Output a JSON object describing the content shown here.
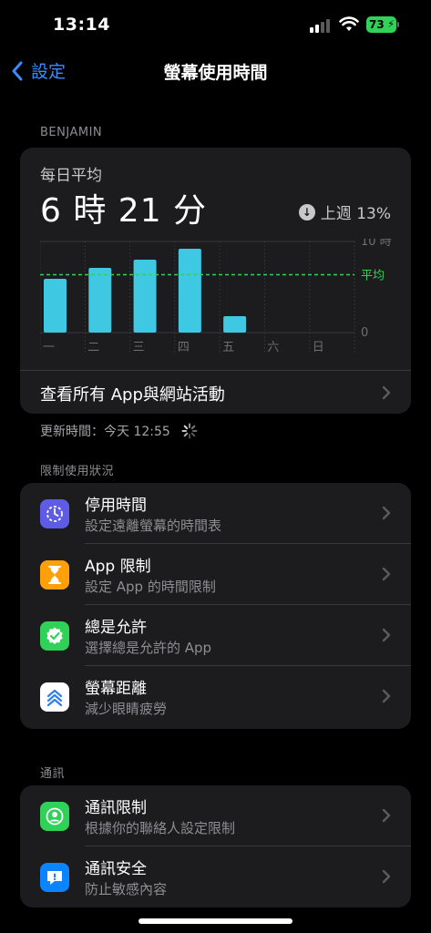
{
  "status": {
    "time": "13:14",
    "battery": "73"
  },
  "nav": {
    "back_label": "設定",
    "title": "螢幕使用時間"
  },
  "user_label": "BENJAMIN",
  "summary": {
    "daily_label": "每日平均",
    "total": "6 時 21 分",
    "trend_text": "上週 13%",
    "link_label": "查看所有 App與網站活動"
  },
  "chart_data": {
    "type": "bar",
    "categories": [
      "一",
      "二",
      "三",
      "四",
      "五",
      "六",
      "日"
    ],
    "values": [
      5.9,
      7.1,
      8.0,
      9.2,
      1.8,
      0,
      0
    ],
    "ylim": [
      0,
      10
    ],
    "y_tick_labels": [
      "10 時",
      "0"
    ],
    "average": 6.35,
    "average_label": "平均",
    "bar_color": "#3fc8e2",
    "average_color": "#32d158"
  },
  "updated_text": "更新時間：今天 12:55",
  "limits": {
    "section_label": "限制使用狀況",
    "items": [
      {
        "title": "停用時間",
        "subtitle": "設定遠離螢幕的時間表",
        "icon": "moon-clock-icon",
        "color": "#5e5ce6"
      },
      {
        "title": "App 限制",
        "subtitle": "設定 App 的時間限制",
        "icon": "hourglass-icon",
        "color": "#ff9f0a"
      },
      {
        "title": "總是允許",
        "subtitle": "選擇總是允許的 App",
        "icon": "checkmark-seal-icon",
        "color": "#30d158"
      },
      {
        "title": "螢幕距離",
        "subtitle": "減少眼睛疲勞",
        "icon": "chevrons-up-icon",
        "color": "#ffffff"
      }
    ]
  },
  "communication": {
    "section_label": "通訊",
    "items": [
      {
        "title": "通訊限制",
        "subtitle": "根據你的聯絡人設定限制",
        "icon": "person-circle-icon",
        "color": "#30d158"
      },
      {
        "title": "通訊安全",
        "subtitle": "防止敏感內容",
        "icon": "message-warning-icon",
        "color": "#0a84ff"
      }
    ]
  }
}
